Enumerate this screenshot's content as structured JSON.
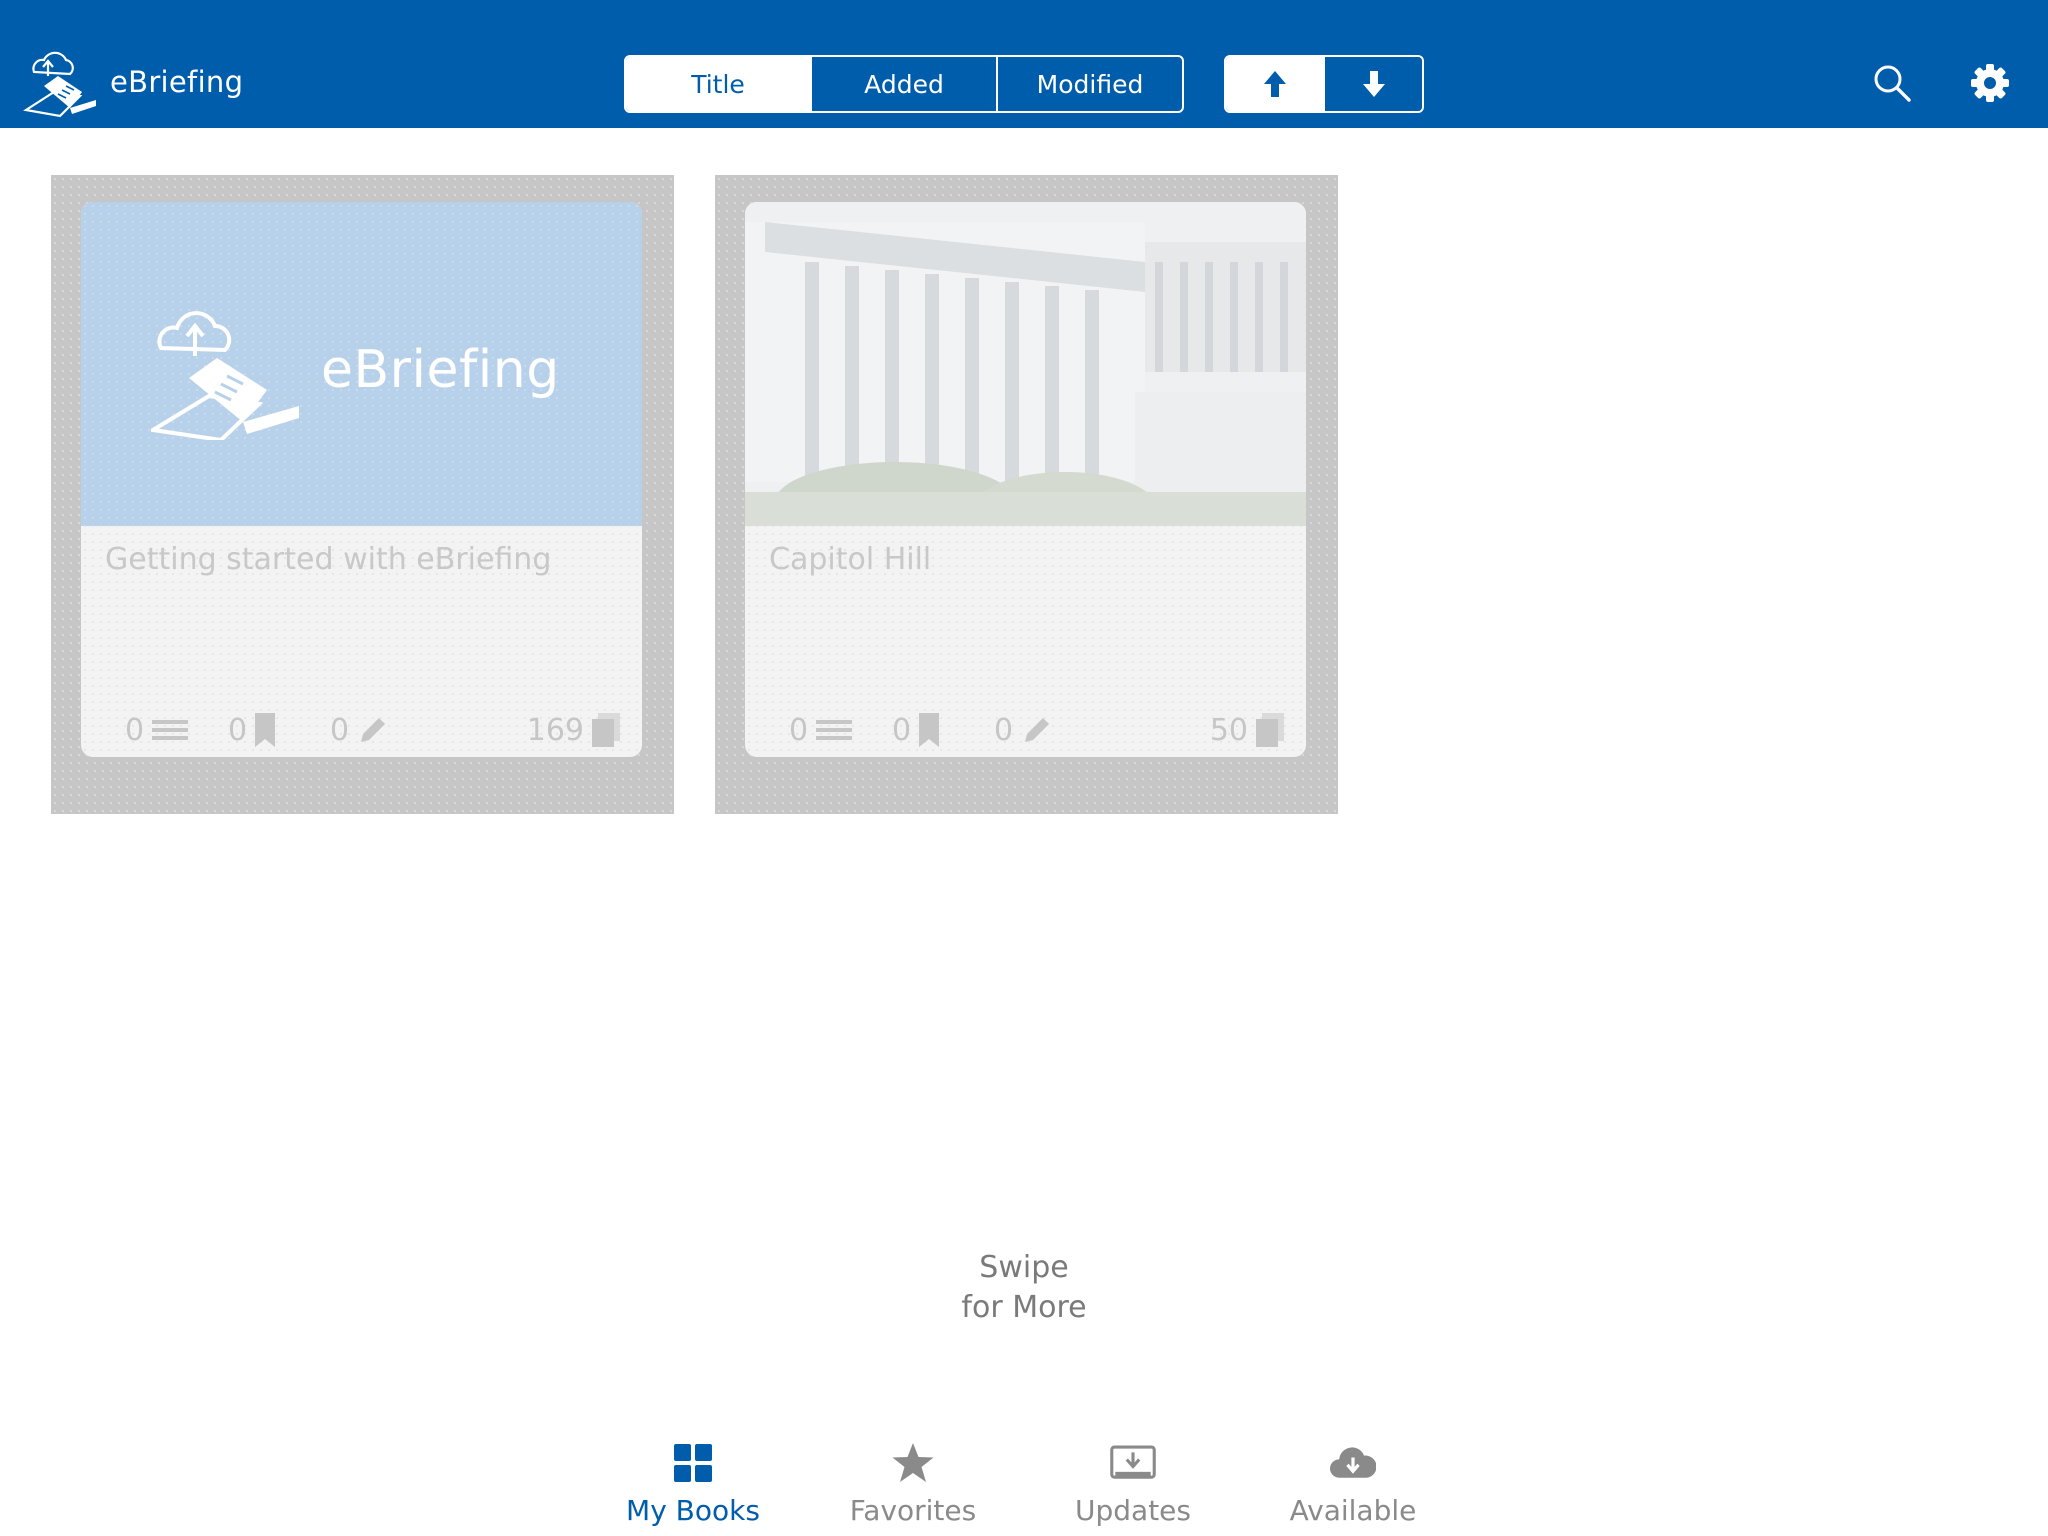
{
  "app": {
    "name": "eBriefing"
  },
  "toolbar": {
    "sort_tabs": [
      {
        "label": "Title",
        "active": true
      },
      {
        "label": "Added",
        "active": false
      },
      {
        "label": "Modified",
        "active": false
      }
    ],
    "order_buttons": [
      {
        "icon": "arrow-up-icon",
        "active": true
      },
      {
        "icon": "arrow-down-icon",
        "active": false
      }
    ],
    "search_icon": "search-icon",
    "settings_icon": "gear-icon"
  },
  "books": [
    {
      "title": "Getting started with eBriefing",
      "cover_text": "eBriefing",
      "cover": "ebriefing-logo-blue",
      "notes": "0",
      "bookmarks": "0",
      "annotations": "0",
      "pages": "169"
    },
    {
      "title": "Capitol Hill",
      "cover_text": "",
      "cover": "capitol-building-photo",
      "notes": "0",
      "bookmarks": "0",
      "annotations": "0",
      "pages": "50"
    }
  ],
  "swipe_hint": {
    "line1": "Swipe",
    "line2": "for More"
  },
  "tabs": [
    {
      "label": "My Books",
      "icon": "grid-icon",
      "active": true
    },
    {
      "label": "Favorites",
      "icon": "star-icon",
      "active": false
    },
    {
      "label": "Updates",
      "icon": "updates-icon",
      "active": false
    },
    {
      "label": "Available",
      "icon": "cloud-download-icon",
      "active": false
    }
  ],
  "colors": {
    "brand_blue": "#005dab",
    "card_frame": "#c6c6c6",
    "cover_blue": "#b8d1ea",
    "inactive_tab": "#8a8a8a"
  }
}
